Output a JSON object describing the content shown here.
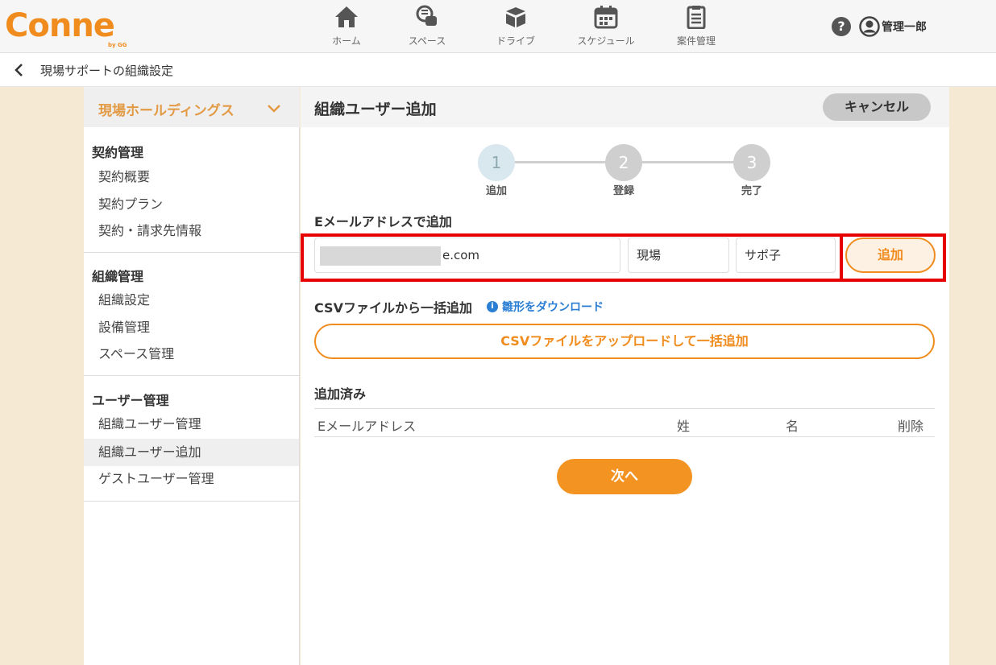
{
  "header": {
    "logo_text": "Conne",
    "logo_sub": "by GG",
    "nav": [
      {
        "label": "ホーム",
        "icon": "home-icon"
      },
      {
        "label": "スペース",
        "icon": "chat-bubbles-icon"
      },
      {
        "label": "ドライブ",
        "icon": "box-icon"
      },
      {
        "label": "スケジュール",
        "icon": "calendar-icon"
      },
      {
        "label": "案件管理",
        "icon": "clipboard-icon"
      }
    ],
    "help_icon": "?",
    "user_name": "管理一郎"
  },
  "breadcrumb": {
    "title": "現場サポートの組織設定"
  },
  "sidebar": {
    "org_name": "現場ホールディングス",
    "groups": [
      {
        "heading": "契約管理",
        "items": [
          "契約概要",
          "契約プラン",
          "契約・請求先情報"
        ]
      },
      {
        "heading": "組織管理",
        "items": [
          "組織設定",
          "設備管理",
          "スペース管理"
        ]
      },
      {
        "heading": "ユーザー管理",
        "items": [
          "組織ユーザー管理",
          "組織ユーザー追加",
          "ゲストユーザー管理"
        ]
      }
    ],
    "active_item": "組織ユーザー追加"
  },
  "main": {
    "title": "組織ユーザー追加",
    "cancel_label": "キャンセル",
    "steps": [
      {
        "number": "1",
        "label": "追加"
      },
      {
        "number": "2",
        "label": "登録"
      },
      {
        "number": "3",
        "label": "完了"
      }
    ],
    "current_step": 1,
    "email_section_label": "Eメールアドレスで追加",
    "email_value_visible": "e.com",
    "last_name_value": "現場",
    "first_name_value": "サポ子",
    "add_label": "追加",
    "csv_title": "CSVファイルから一括追加",
    "template_link": "雛形をダウンロード",
    "upload_label": "CSVファイルをアップロードして一括追加",
    "added_title": "追加済み",
    "table_headers": [
      "Eメールアドレス",
      "姓",
      "名",
      "削除"
    ],
    "next_label": "次へ"
  },
  "colors": {
    "accent": "#f08c1e",
    "highlight_frame": "#e60000",
    "link": "#2a7fd4",
    "page_bg": "#f5e9d3"
  }
}
